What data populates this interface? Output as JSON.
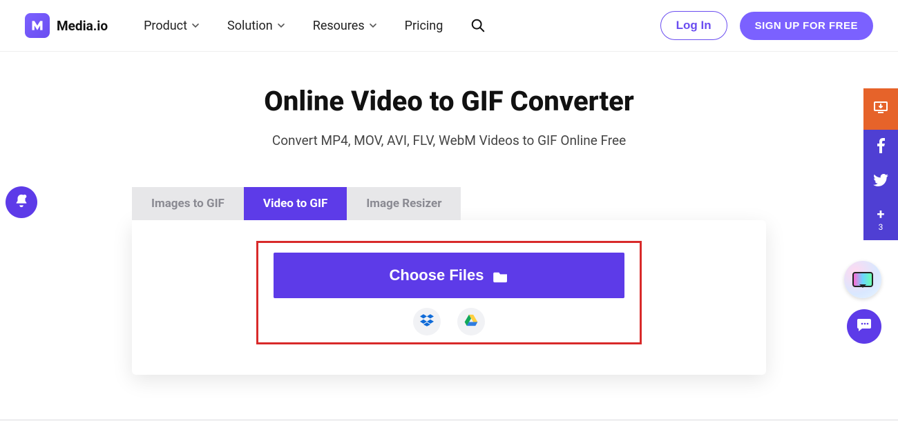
{
  "header": {
    "logo_text": "Media.io",
    "nav": {
      "product": "Product",
      "solution": "Solution",
      "resources": "Resoures",
      "pricing": "Pricing"
    },
    "login": "Log In",
    "signup": "SIGN UP FOR FREE"
  },
  "main": {
    "title": "Online Video to GIF Converter",
    "subtitle": "Convert MP4, MOV, AVI, FLV, WebM Videos to GIF Online Free",
    "tabs": {
      "images_to_gif": "Images to GIF",
      "video_to_gif": "Video to GIF",
      "image_resizer": "Image Resizer"
    },
    "choose_files": "Choose Files"
  },
  "share_rail": {
    "plus_count": "3"
  }
}
